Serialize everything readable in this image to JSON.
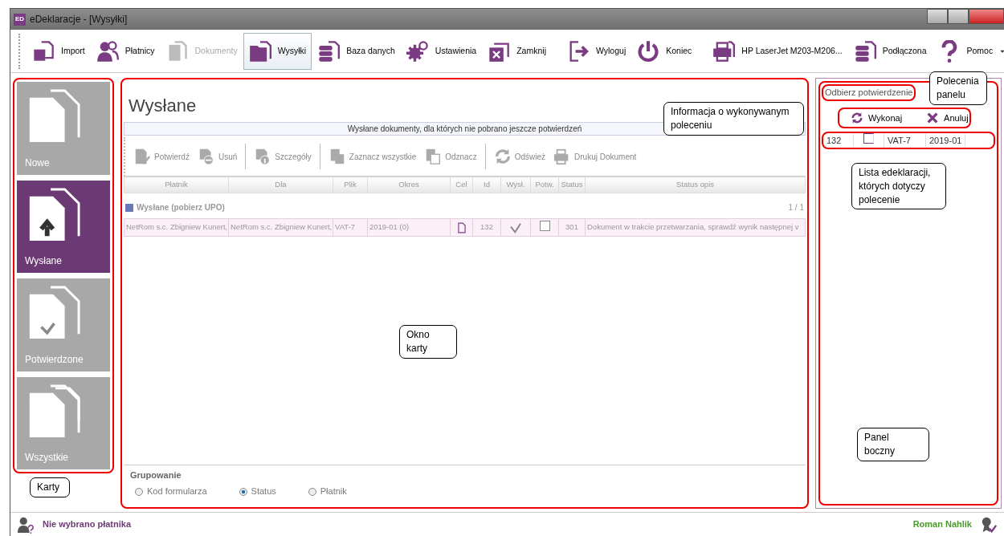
{
  "window": {
    "title": "eDeklaracje - [Wysyłki]",
    "app_badge": "ED"
  },
  "toolbar": [
    {
      "label": "Import",
      "disabled": false,
      "selected": false
    },
    {
      "label": "Płatnicy",
      "disabled": false,
      "selected": false
    },
    {
      "label": "Dokumenty",
      "disabled": true,
      "selected": false
    },
    {
      "label": "Wysyłki",
      "disabled": false,
      "selected": true
    },
    {
      "label": "Baza danych",
      "disabled": false,
      "selected": false
    },
    {
      "label": "Ustawienia",
      "disabled": false,
      "selected": false
    },
    {
      "label": "Zamknij",
      "disabled": false,
      "selected": false
    },
    {
      "label": "Wyloguj",
      "disabled": false,
      "selected": false
    },
    {
      "label": "Koniec",
      "disabled": false,
      "selected": false
    },
    {
      "label": "HP LaserJet M203-M206...",
      "disabled": false,
      "selected": false
    },
    {
      "label": "Podłączona",
      "disabled": false,
      "selected": false
    },
    {
      "label": "Pomoc",
      "disabled": false,
      "selected": false,
      "dropdown": true
    }
  ],
  "tiles": [
    {
      "label": "Nowe",
      "kind": "new",
      "selected": false
    },
    {
      "label": "Wysłane",
      "kind": "sent",
      "selected": true
    },
    {
      "label": "Potwierdzone",
      "kind": "confirmed",
      "selected": false
    },
    {
      "label": "Wszystkie",
      "kind": "all",
      "selected": false
    }
  ],
  "card": {
    "title": "Wysłane",
    "subtitle": "Wysłane dokumenty, dla których nie pobrano jeszcze potwierdzeń",
    "actions": [
      {
        "label": "Potwierdź"
      },
      {
        "label": "Usuń"
      },
      {
        "label": "Szczegóły"
      },
      {
        "label": "Zaznacz wszystkie"
      },
      {
        "label": "Odznacz"
      },
      {
        "label": "Odśwież"
      },
      {
        "label": "Drukuj Dokument"
      }
    ],
    "table": {
      "columns": [
        "Płatnik",
        "Dla",
        "Plik",
        "Okres",
        "Cel",
        "Id",
        "Wysł.",
        "Potw.",
        "Status",
        "Status opis"
      ],
      "group": {
        "label": "Wysłane (pobierz UPO)",
        "count": "1 / 1",
        "expanded": true
      },
      "rows": [
        {
          "platnik": "NetRom s.c. Zbigniew Kunert,",
          "dla": "NetRom s.c. Zbigniew Kunert,",
          "plik": "VAT-7",
          "okres": "2019-01 (0)",
          "id": "132",
          "sent": true,
          "confirmed": false,
          "status": "301",
          "status_opis": "Dokument w trakcie przetwarzania, sprawdź wynik następnej v"
        }
      ]
    },
    "grouping": {
      "label": "Grupowanie",
      "options": [
        {
          "label": "Kod formularza",
          "selected": false
        },
        {
          "label": "Status",
          "selected": true
        },
        {
          "label": "Płatnik",
          "selected": false
        }
      ]
    }
  },
  "side_panel": {
    "title": "Odbierz potwierdzenie",
    "actions": [
      {
        "label": "Wykonaj"
      },
      {
        "label": "Anuluj"
      }
    ],
    "rows": [
      {
        "id": "132",
        "checked": false,
        "plik": "VAT-7",
        "okres": "2019-01"
      }
    ]
  },
  "status_bar": {
    "left": "Nie wybrano płatnika",
    "right": "Roman Nahlik"
  },
  "callouts": [
    {
      "text": "Informacja o wykonywanym poleceniu"
    },
    {
      "text": "Polecenia panelu"
    },
    {
      "text": "Lista edeklaracji, których dotyczy polecenie"
    },
    {
      "text": "Okno karty"
    },
    {
      "text": "Panel boczny"
    },
    {
      "text": "Karty"
    }
  ]
}
